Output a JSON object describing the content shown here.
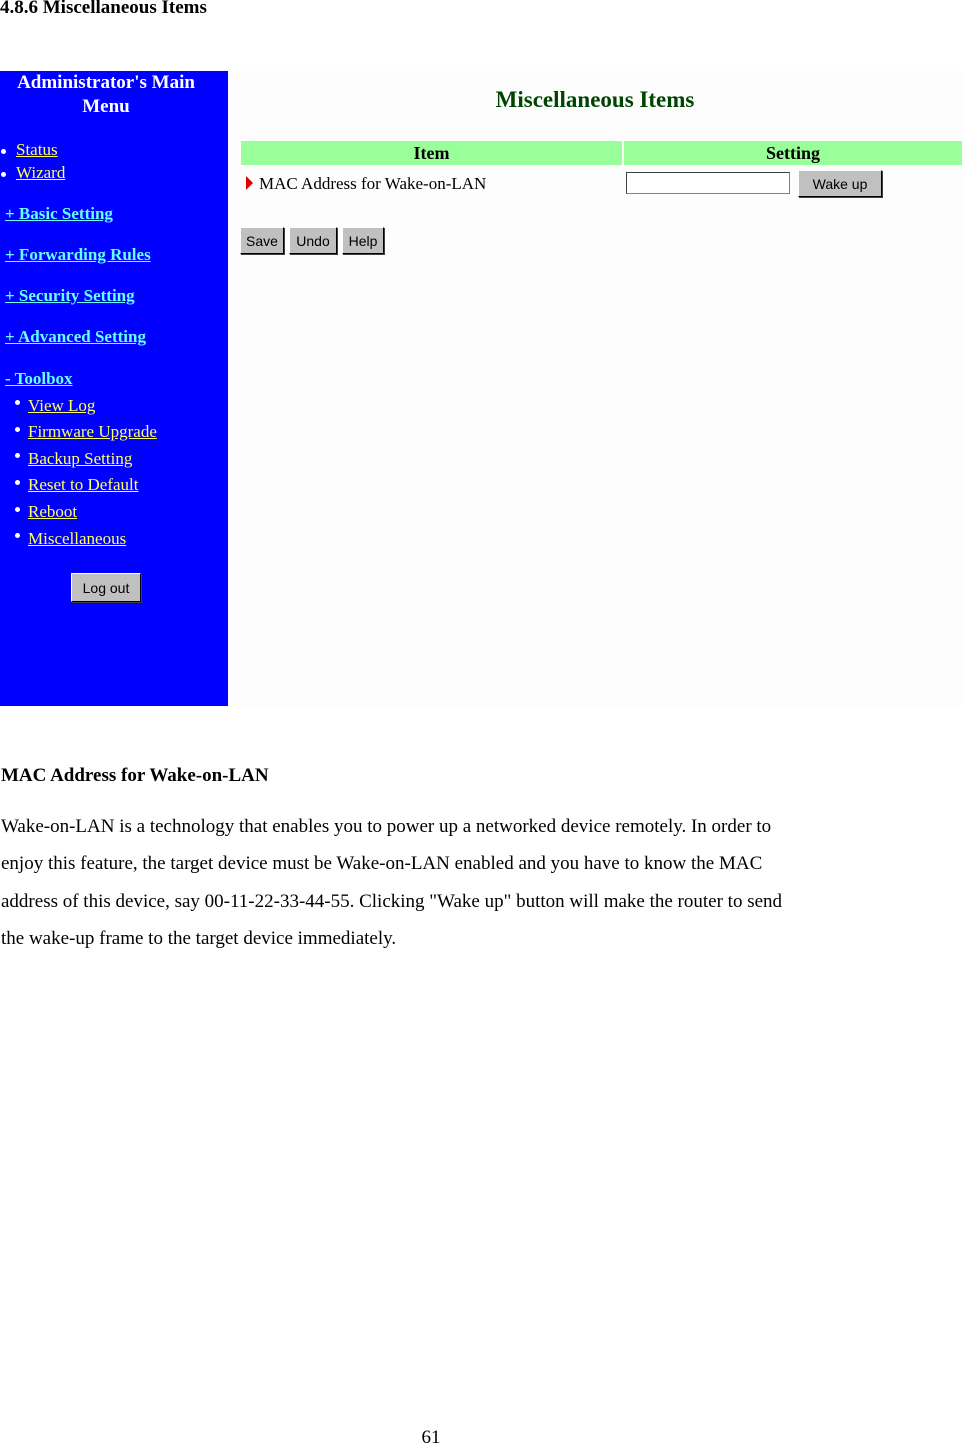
{
  "document": {
    "section_heading": "4.8.6 Miscellaneous Items",
    "paragraph_heading": "MAC Address for Wake-on-LAN",
    "paragraph_lines": [
      "Wake-on-LAN is a technology that enables you to power up a networked device remotely. In order to",
      "enjoy this feature, the target device must be Wake-on-LAN enabled and you have to know the MAC",
      "address of this device, say 00-11-22-33-44-55. Clicking \"Wake up\" button will make the router to send",
      "the wake-up frame to the target device immediately."
    ],
    "page_number": "61"
  },
  "sidebar": {
    "title_line1": "Administrator's Main",
    "title_line2": "Menu",
    "top_links": [
      "Status",
      "Wizard"
    ],
    "sections": [
      "+ Basic Setting",
      "+ Forwarding Rules",
      "+ Security Setting",
      "+ Advanced Setting",
      "- Toolbox"
    ],
    "toolbox_items": [
      "View Log",
      "Firmware Upgrade",
      "Backup Setting",
      "Reset to Default",
      "Reboot",
      "Miscellaneous"
    ],
    "logout_label": "Log out",
    "colors": {
      "background": "#0000ff",
      "link": "#ffff66",
      "section_link": "#66ffff"
    }
  },
  "main": {
    "title": "Miscellaneous Items",
    "table": {
      "headers": [
        "Item",
        "Setting"
      ],
      "rows": [
        {
          "label": "MAC Address for Wake-on-LAN",
          "input_value": "",
          "button": "Wake up"
        }
      ]
    },
    "buttons": [
      "Save",
      "Undo",
      "Help"
    ],
    "colors": {
      "header_bg": "#99ff99",
      "title": "#004400",
      "arrow": "#e00000"
    }
  }
}
